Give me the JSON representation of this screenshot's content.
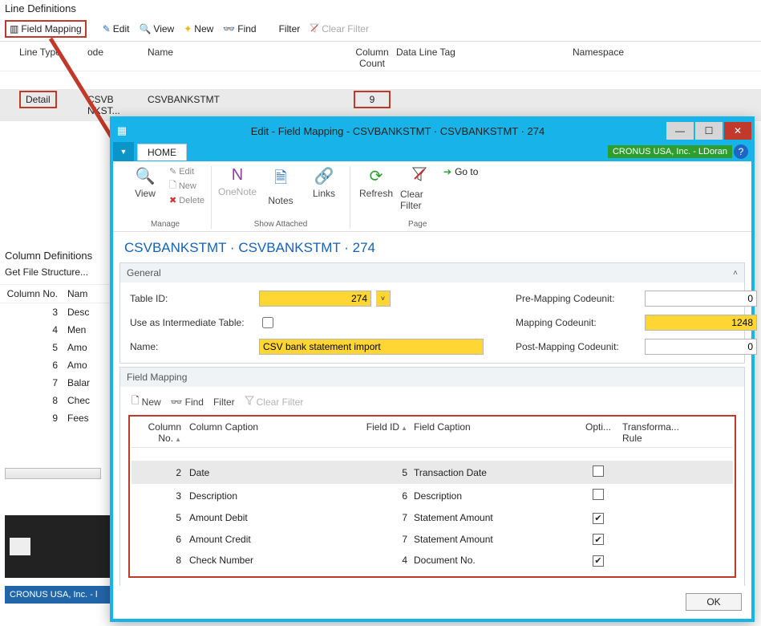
{
  "line_def": {
    "title": "Line Definitions",
    "toolbar": {
      "field_mapping": "Field Mapping",
      "edit": "Edit",
      "view": "View",
      "new": "New",
      "find": "Find",
      "filter": "Filter",
      "clear_filter": "Clear Filter"
    },
    "columns": [
      "Line Type",
      "ode",
      "Name",
      "Column Count",
      "Data Line Tag",
      "Namespace"
    ],
    "row": {
      "type": "Detail",
      "code": "CSVB    NKST...",
      "name": "CSVBANKSTMT",
      "count": "9",
      "tag": "",
      "ns": ""
    }
  },
  "col_def": {
    "title": "Column Definitions",
    "get_file": "Get File Structure...",
    "col1": "Column No.",
    "col2": "Nam",
    "rows": [
      {
        "no": "3",
        "nm": "Desc"
      },
      {
        "no": "4",
        "nm": "Men"
      },
      {
        "no": "5",
        "nm": "Amo"
      },
      {
        "no": "6",
        "nm": "Amo"
      },
      {
        "no": "7",
        "nm": "Balar"
      },
      {
        "no": "8",
        "nm": "Chec"
      },
      {
        "no": "9",
        "nm": "Fees"
      }
    ]
  },
  "status": "CRONUS USA, Inc. - l",
  "modal": {
    "title": "Edit - Field Mapping - CSVBANKSTMT · CSVBANKSTMT · 274",
    "home_tab": "HOME",
    "company": "CRONUS USA, Inc. - LDoran",
    "ribbon": {
      "view": "View",
      "edit": "Edit",
      "new": "New",
      "delete": "Delete",
      "manage": "Manage",
      "onenote": "OneNote",
      "notes": "Notes",
      "links": "Links",
      "show_attached": "Show Attached",
      "refresh": "Refresh",
      "clear_filter": "Clear Filter",
      "goto": "Go to",
      "page": "Page"
    },
    "breadcrumb": "CSVBANKSTMT · CSVBANKSTMT · 274",
    "general": {
      "title": "General",
      "table_id_lbl": "Table ID:",
      "table_id": "274",
      "intermediate_lbl": "Use as Intermediate Table:",
      "name_lbl": "Name:",
      "name": "CSV bank statement import",
      "pre_lbl": "Pre-Mapping Codeunit:",
      "pre": "0",
      "map_lbl": "Mapping Codeunit:",
      "map": "1248",
      "post_lbl": "Post-Mapping Codeunit:",
      "post": "0"
    },
    "fm": {
      "title": "Field Mapping",
      "tb": {
        "new": "New",
        "find": "Find",
        "filter": "Filter",
        "clear": "Clear Filter"
      },
      "cols": {
        "no": "Column No.",
        "cap": "Column Caption",
        "fid": "Field ID",
        "fcap": "Field Caption",
        "opt": "Opti...",
        "tr": "Transforma...",
        "tr2": "Rule"
      },
      "rows": [
        {
          "no": "2",
          "cap": "Date",
          "fid": "5",
          "fcap": "Transaction Date",
          "opt": false
        },
        {
          "no": "3",
          "cap": "Description",
          "fid": "6",
          "fcap": "Description",
          "opt": false
        },
        {
          "no": "5",
          "cap": "Amount Debit",
          "fid": "7",
          "fcap": "Statement Amount",
          "opt": true
        },
        {
          "no": "6",
          "cap": "Amount Credit",
          "fid": "7",
          "fcap": "Statement Amount",
          "opt": true
        },
        {
          "no": "8",
          "cap": "Check Number",
          "fid": "4",
          "fcap": "Document No.",
          "opt": true
        }
      ]
    },
    "ok": "OK"
  }
}
